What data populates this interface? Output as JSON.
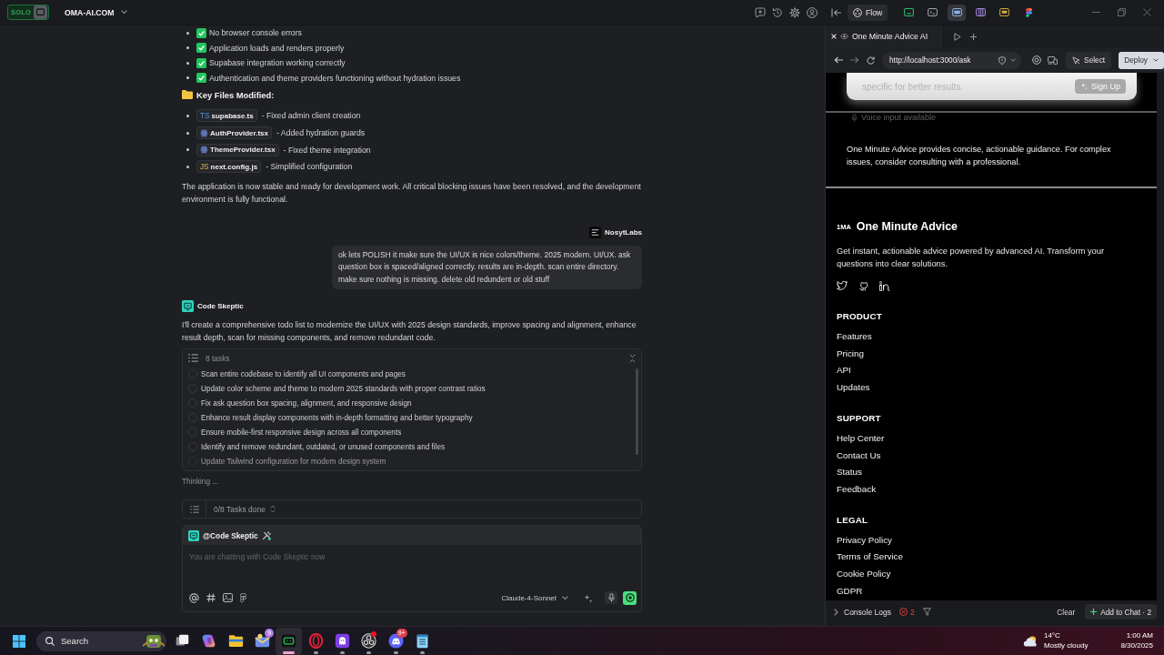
{
  "app_bar": {
    "logo": "SOLO",
    "project": "OMA-AI.COM",
    "flow_button": "Flow",
    "views": [
      {
        "kind": "code",
        "selected": false
      },
      {
        "kind": "terminal",
        "selected": false
      },
      {
        "kind": "browser",
        "selected": true
      },
      {
        "kind": "panels",
        "selected": false
      },
      {
        "kind": "inbox",
        "selected": false
      },
      {
        "kind": "figma",
        "selected": false
      }
    ]
  },
  "chat": {
    "checks": [
      {
        "text": "No browser console errors",
        "checked": true
      },
      {
        "text": "Application loads and renders properly",
        "checked": true
      },
      {
        "text": "Supabase integration working correctly",
        "checked": true
      },
      {
        "text": "Authentication and theme providers functioning without hydration issues",
        "checked": true
      }
    ],
    "files_heading": "Key Files Modified:",
    "files": [
      {
        "kind": "ts",
        "badge": "TS",
        "name": "supabase.ts",
        "note": "- Fixed admin client creation"
      },
      {
        "kind": "react",
        "name": "AuthProvider.tsx",
        "note": "- Added hydration guards"
      },
      {
        "kind": "react",
        "name": "ThemeProvider.tsx",
        "note": "- Fixed theme integration"
      },
      {
        "kind": "js",
        "badge": "JS",
        "name": "next.config.js",
        "note": "- Simplified configuration"
      }
    ],
    "summary": "The application is now stable and ready for development work. All critical blocking issues have been resolved, and the development environment is fully functional.",
    "user_message": {
      "author": "NosytLabs",
      "text": "ok lets POLISH it make sure the UI/UX is nice colors/theme. 2025 modern. UI/UX. ask question box is spaced/aligned correctly. results are in-depth. scan entire directory. make sure nothing is missing. delete old redundent or old stuff"
    },
    "agent_message": {
      "author": "Code Skeptic",
      "text": "I'll create a comprehensive todo list to modernize the UI/UX with 2025 design standards, improve spacing and alignment, enhance result depth, scan for missing components, and remove redundant code."
    },
    "todo": {
      "title": "8 tasks",
      "items": [
        {
          "text": "Scan entire codebase to identify all UI components and pages",
          "checked": false
        },
        {
          "text": "Update color scheme and theme to modern 2025 standards with proper contrast ratios",
          "checked": false
        },
        {
          "text": "Fix ask question box spacing, alignment, and responsive design",
          "checked": false
        },
        {
          "text": "Enhance result display components with in-depth formatting and better typography",
          "checked": false
        },
        {
          "text": "Ensure mobile-first responsive design across all components",
          "checked": false
        },
        {
          "text": "Identify and remove redundant, outdated, or unused components and files",
          "checked": false
        },
        {
          "text": "Update Tailwind configuration for modern design system",
          "checked": false
        }
      ]
    },
    "status": "Thinking ...",
    "progress": "0/8 Tasks done",
    "composer": {
      "agent": "@Code Skeptic",
      "placeholder": "You are chatting with Code Skeptic now",
      "model": "Claude-4-Sonnet"
    }
  },
  "preview": {
    "tab": "One Minute Advice AI",
    "url": "http://localhost:3000/ask",
    "select_button": "Select",
    "deploy_button": "Deploy",
    "page": {
      "input_hint": "specific for better results.",
      "sign_up": "Sign Up",
      "voice_note": "Voice input available",
      "disclaimer": "One Minute Advice provides concise, actionable guidance. For complex issues, consider consulting with a professional.",
      "footer": {
        "logo": "1MA",
        "brand": "One Minute Advice",
        "tagline": "Get instant, actionable advice powered by advanced AI. Transform your questions into clear solutions.",
        "socials": [
          {
            "kind": "twitter"
          },
          {
            "kind": "github"
          },
          {
            "kind": "linkedin"
          }
        ],
        "sections": [
          {
            "title": "PRODUCT",
            "links": [
              "Features",
              "Pricing",
              "API",
              "Updates"
            ]
          },
          {
            "title": "SUPPORT",
            "links": [
              "Help Center",
              "Contact Us",
              "Status",
              "Feedback"
            ]
          },
          {
            "title": "LEGAL",
            "links": [
              "Privacy Policy",
              "Terms of Service",
              "Cookie Policy",
              "GDPR"
            ]
          }
        ]
      }
    },
    "console": {
      "label": "Console Logs",
      "errors": "2",
      "clear": "Clear",
      "add_to_chat": "Add to Chat · 2"
    }
  },
  "taskbar": {
    "search": {
      "placeholder": "Search"
    },
    "apps": [
      {
        "kind": "task-view",
        "selected": false,
        "running": false,
        "alert": false
      },
      {
        "kind": "copilot",
        "selected": false,
        "running": false,
        "alert": false
      },
      {
        "kind": "explorer",
        "selected": false,
        "running": false,
        "alert": false
      },
      {
        "kind": "mail",
        "badge": "9",
        "selected": false,
        "running": false,
        "alert": false
      },
      {
        "kind": "solo",
        "selected": true,
        "running": true,
        "alert": false
      },
      {
        "kind": "opera",
        "selected": false,
        "running": true,
        "alert": false
      },
      {
        "kind": "ghost",
        "selected": false,
        "running": true,
        "alert": false
      },
      {
        "kind": "obs",
        "selected": false,
        "running": true,
        "alert": true
      },
      {
        "kind": "discord",
        "badge": "9+",
        "selected": false,
        "running": true,
        "alert": false
      },
      {
        "kind": "notepad",
        "selected": false,
        "running": true,
        "alert": false
      }
    ],
    "weather": {
      "temp": "14°C",
      "condition": "Mostly cloudy"
    },
    "clock": {
      "time": "1:00 AM",
      "date": "8/30/2025"
    }
  }
}
